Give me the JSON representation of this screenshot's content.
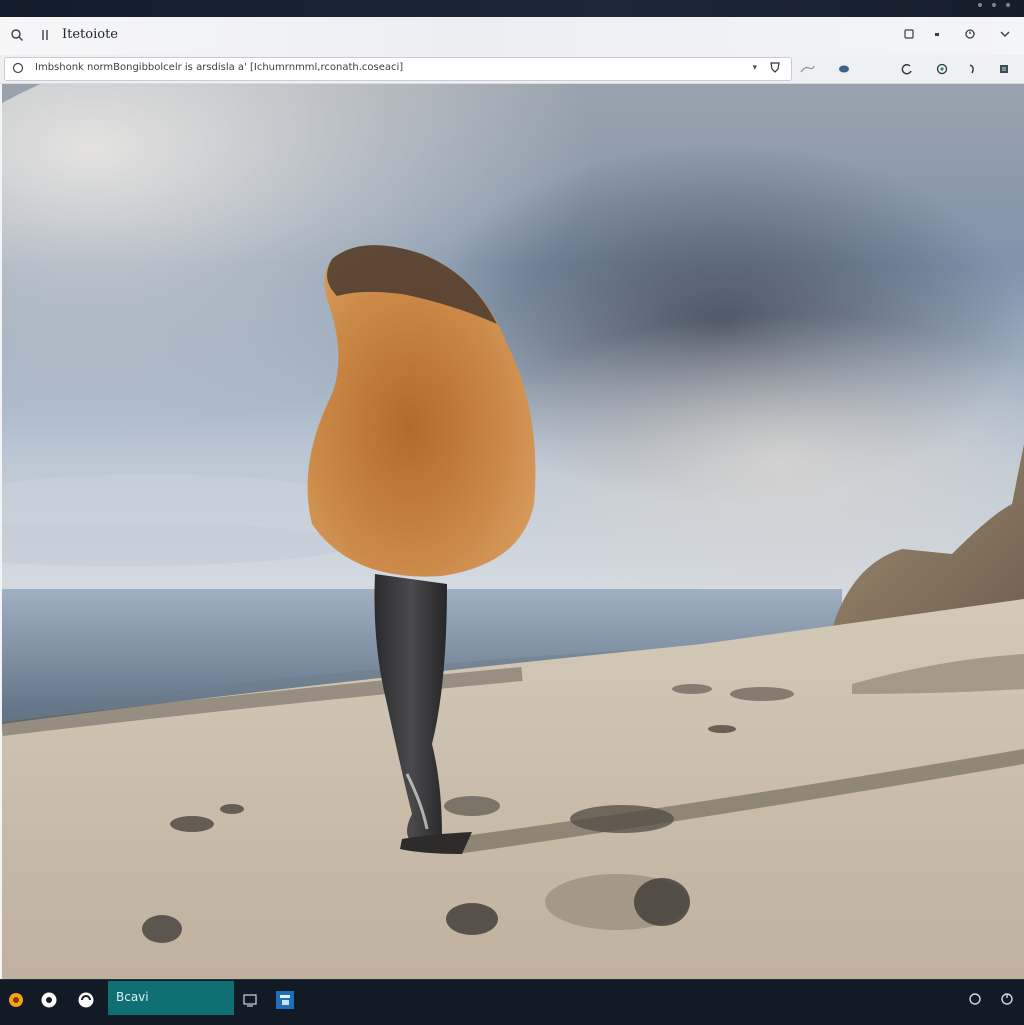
{
  "browser": {
    "tab_title": "Itetoiote",
    "address_url": "Imbshonk normBongibbolcelr is arsdisla a' [Ichumrnmml,rconath.coseaci]",
    "icons": {
      "search": "search-icon",
      "pin": "pin-icon",
      "lock": "lock-icon",
      "dropdown": "chevron-down-icon",
      "favorite": "shield-icon",
      "extensions": [
        "puzzle-icon",
        "profile-icon",
        "refresh-icon",
        "download-icon",
        "menu-icon"
      ]
    },
    "window_controls": [
      "square-icon",
      "minimize-icon",
      "settings-icon",
      "chevron-down-icon"
    ]
  },
  "taskbar": {
    "active_app_label": "Bcavi",
    "apps": [
      "orange-app-icon",
      "chat-app-icon",
      "browser-app-icon",
      "monitor-app-icon",
      "blue-app-icon"
    ],
    "tray": [
      "circle-icon",
      "power-icon"
    ]
  },
  "colors": {
    "taskbar_bg": "#121a25",
    "active_app": "#0f6f73",
    "sky": "#8aa5c6",
    "sand": "#c8bcab",
    "creature_body": "#c27a3a"
  }
}
